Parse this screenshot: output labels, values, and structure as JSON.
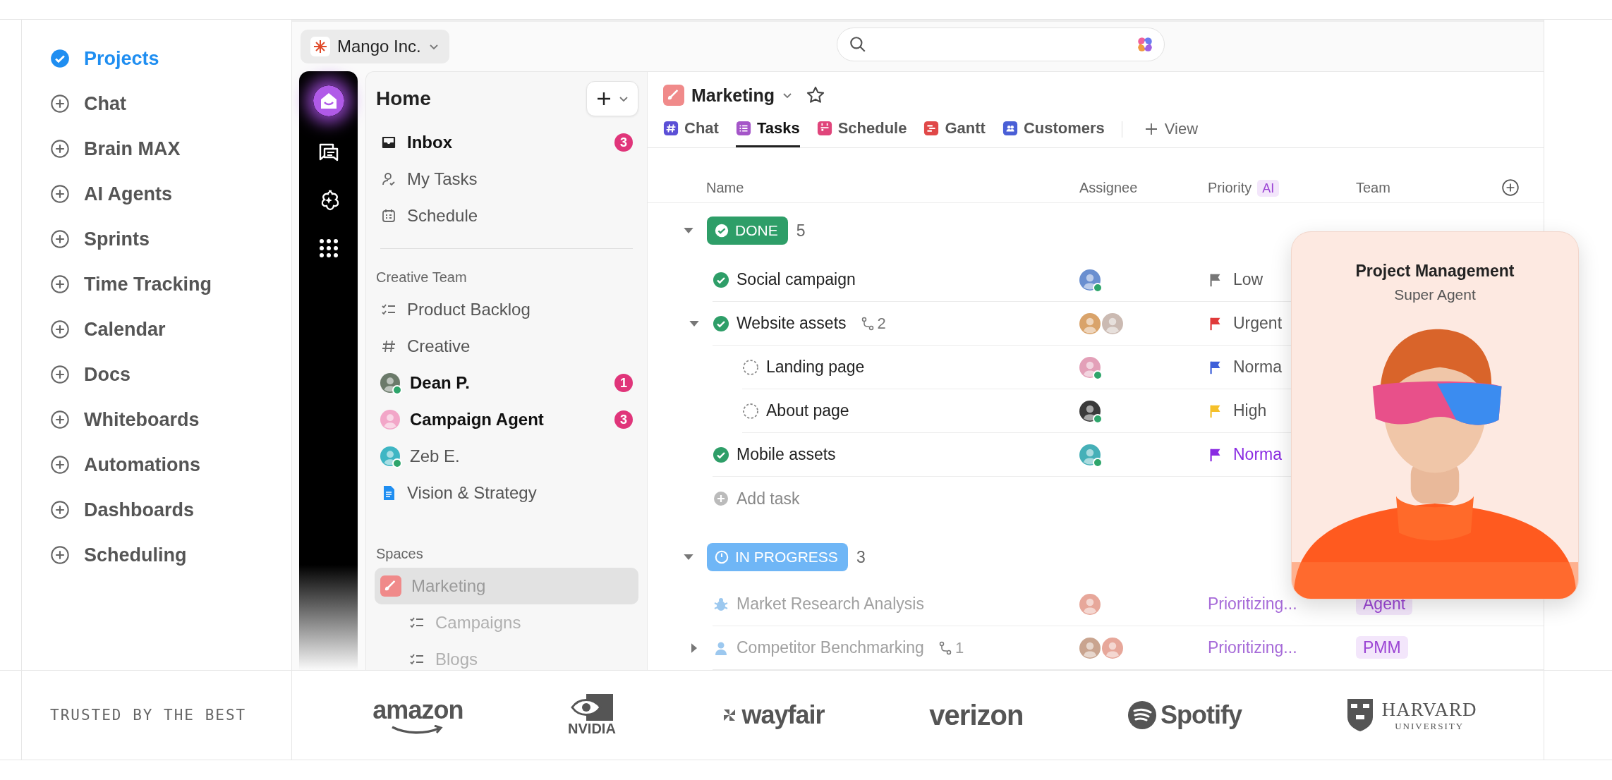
{
  "nav": [
    {
      "label": "Projects",
      "selected": true
    },
    {
      "label": "Chat",
      "selected": false
    },
    {
      "label": "Brain MAX",
      "selected": false
    },
    {
      "label": "AI Agents",
      "selected": false
    },
    {
      "label": "Sprints",
      "selected": false
    },
    {
      "label": "Time Tracking",
      "selected": false
    },
    {
      "label": "Calendar",
      "selected": false
    },
    {
      "label": "Docs",
      "selected": false
    },
    {
      "label": "Whiteboards",
      "selected": false
    },
    {
      "label": "Automations",
      "selected": false
    },
    {
      "label": "Dashboards",
      "selected": false
    },
    {
      "label": "Scheduling",
      "selected": false
    }
  ],
  "workspace": {
    "name": "Mango Inc."
  },
  "sidebar": {
    "title": "Home",
    "items": [
      {
        "label": "Inbox",
        "kind": "inbox",
        "unread": true,
        "badge": "3",
        "selected": false
      },
      {
        "label": "My Tasks",
        "kind": "tasks",
        "unread": false,
        "selected": false
      },
      {
        "label": "Schedule",
        "kind": "calendar",
        "unread": false,
        "selected": false
      }
    ],
    "sections": [
      {
        "title": "Creative Team",
        "items": [
          {
            "label": "Product Backlog",
            "kind": "list",
            "unread": false,
            "selected": false
          },
          {
            "label": "Creative",
            "kind": "hash",
            "unread": false,
            "selected": false
          },
          {
            "label": "Dean P.",
            "kind": "avatar",
            "color": "#6b7a6a",
            "online": true,
            "unread": true,
            "badge": "1",
            "selected": false
          },
          {
            "label": "Campaign Agent",
            "kind": "avatar",
            "color": "#f2a6c8",
            "online": false,
            "unread": true,
            "badge": "3",
            "selected": false
          },
          {
            "label": "Zeb E.",
            "kind": "avatar",
            "color": "#3fb6c4",
            "online": true,
            "unread": false,
            "selected": false
          },
          {
            "label": "Vision & Strategy",
            "kind": "doc",
            "unread": false,
            "selected": false
          }
        ]
      },
      {
        "title": "Spaces",
        "items": [
          {
            "label": "Marketing",
            "kind": "space",
            "unread": false,
            "selected": true,
            "children": [
              {
                "label": "Campaigns",
                "kind": "list",
                "unread": false,
                "selected": false
              },
              {
                "label": "Blogs",
                "kind": "list",
                "unread": false,
                "selected": false
              }
            ]
          }
        ]
      }
    ]
  },
  "space": {
    "name": "Marketing",
    "starred": false
  },
  "tabs": [
    {
      "label": "Chat",
      "kind": "hash",
      "color": "#5b4fd6",
      "selected": false
    },
    {
      "label": "Tasks",
      "kind": "list",
      "color": "#a455c8",
      "selected": true
    },
    {
      "label": "Schedule",
      "kind": "calendar",
      "color": "#e0457b",
      "selected": false
    },
    {
      "label": "Gantt",
      "kind": "gantt",
      "color": "#e04848",
      "selected": false
    },
    {
      "label": "Customers",
      "kind": "people",
      "color": "#4a5fd6",
      "selected": false
    }
  ],
  "add_view": {
    "label": "View"
  },
  "columns": [
    {
      "label": "Name"
    },
    {
      "label": "Assignee"
    },
    {
      "label": "Priority",
      "badge": "AI"
    },
    {
      "label": "Team"
    }
  ],
  "groups": [
    {
      "label": "DONE",
      "kind": "done",
      "color": "#2e9e68",
      "count": "5",
      "expanded": true,
      "add_label": "Add task",
      "tasks": [
        {
          "name": "Social campaign",
          "kind": "done",
          "assignees": [
            {
              "color": "#6a8fd0",
              "online": true
            }
          ],
          "priority": {
            "label": "Low",
            "color": "#777777",
            "tinted": false
          }
        },
        {
          "name": "Website assets",
          "kind": "done",
          "expanded": true,
          "subtasks": "2",
          "assignees": [
            {
              "color": "#d9a36a",
              "online": false
            },
            {
              "color": "#cbbab2",
              "online": false
            }
          ],
          "priority": {
            "label": "Urgent",
            "color": "#e03a3a",
            "tinted": false
          },
          "children": [
            {
              "name": "Landing page",
              "kind": "open",
              "assignees": [
                {
                  "color": "#e3a0b8",
                  "online": true
                }
              ],
              "priority": {
                "label": "Norma",
                "color": "#3d5fd9",
                "tinted": false
              }
            },
            {
              "name": "About page",
              "kind": "open",
              "assignees": [
                {
                  "color": "#3a3a3a",
                  "online": true
                }
              ],
              "priority": {
                "label": "High",
                "color": "#f5c02a",
                "tinted": false
              }
            }
          ]
        },
        {
          "name": "Mobile assets",
          "kind": "done",
          "assignees": [
            {
              "color": "#46b0b8",
              "online": true
            }
          ],
          "priority": {
            "label": "Norma",
            "color": "#8a2be2",
            "tinted": true
          }
        }
      ]
    },
    {
      "label": "IN PROGRESS",
      "kind": "progress",
      "color": "#6fb6f6",
      "count": "3",
      "expanded": true,
      "tasks": [
        {
          "name": "Market Research Analysis",
          "kind": "bug",
          "assignees": [
            {
              "color": "#e7a79a",
              "online": false
            }
          ],
          "priority": {
            "label": "Prioritizing...",
            "tinted": true
          },
          "team": "Agent"
        },
        {
          "name": "Competitor Benchmarking",
          "kind": "person",
          "expanded": false,
          "subtasks": "1",
          "assignees": [
            {
              "color": "#c9a48f",
              "online": false
            },
            {
              "color": "#e7a79a",
              "online": false
            }
          ],
          "priority": {
            "label": "Prioritizing...",
            "tinted": true
          },
          "team": "PMM"
        }
      ]
    }
  ],
  "agent_card": {
    "title": "Project Management",
    "subtitle": "Super Agent"
  },
  "trusted": {
    "label": "TRUSTED BY THE BEST",
    "logos": [
      {
        "kind": "amazon",
        "name": "amazon"
      },
      {
        "kind": "nvidia",
        "name": "NVIDIA"
      },
      {
        "kind": "wayfair",
        "name": "wayfair"
      },
      {
        "kind": "verizon",
        "name": "verizon"
      },
      {
        "kind": "spotify",
        "name": "Spotify"
      },
      {
        "kind": "harvard",
        "name": "HARVARD",
        "subtitle": "UNIVERSITY"
      }
    ]
  }
}
